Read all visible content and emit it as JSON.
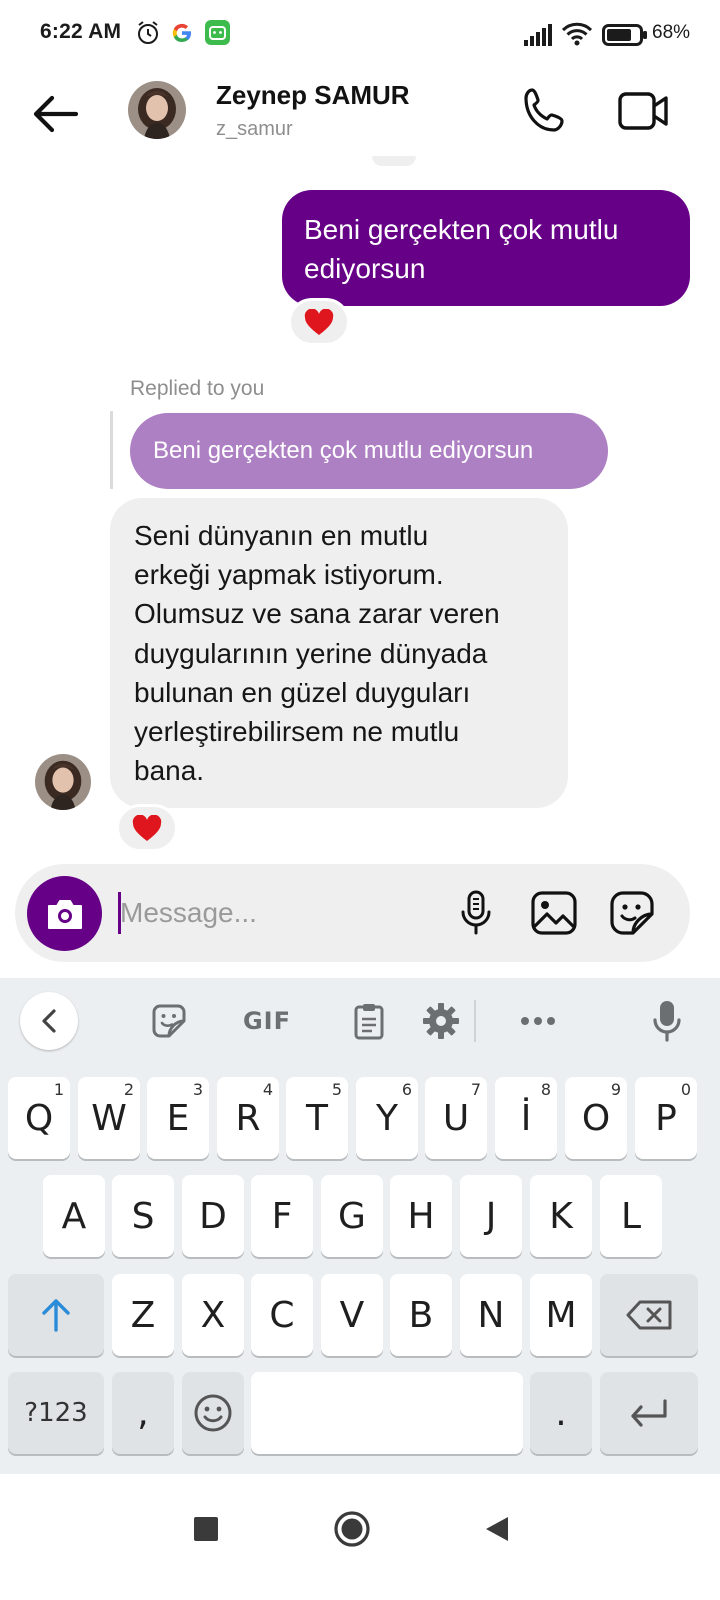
{
  "status_bar": {
    "time": "6:22 AM",
    "battery": "68%",
    "icons": [
      "alarm-icon",
      "google-icon",
      "app-notification-icon",
      "signal-icon",
      "wifi-icon",
      "battery-icon"
    ]
  },
  "header": {
    "name": "Zeynep SAMUR",
    "username": "z_samur",
    "icons": [
      "back-arrow-icon",
      "avatar",
      "phone-icon",
      "video-camera-icon"
    ]
  },
  "messages": [
    {
      "direction": "outgoing",
      "text": "Beni gerçekten çok mutlu ediyorsun",
      "reaction": "❤️"
    },
    {
      "direction": "incoming",
      "reply_label": "Replied to you",
      "quoted_text": "Beni gerçekten çok mutlu ediyorsun",
      "text": "Seni dünyanın en mutlu erkeği yapmak istiyorum. Olumsuz ve sana zarar veren duygularının yerine dünyada bulunan en güzel duyguları yerleştirebilirsem ne mutlu bana.",
      "reaction": "❤️"
    }
  ],
  "incoming_lines": [
    "Seni dünyanın en mutlu",
    "erkeği yapmak istiyorum.",
    "Olumsuz ve sana zarar veren",
    "duygularının yerine dünyada",
    "bulunan en güzel duyguları",
    "yerleştirebilirsem ne mutlu",
    "bana."
  ],
  "outgoing_lines": [
    "Beni gerçekten çok mutlu",
    "ediyorsun"
  ],
  "composer": {
    "value": "",
    "placeholder": "Message...",
    "icons": [
      "camera-icon",
      "microphone-icon",
      "gallery-icon",
      "sticker-icon"
    ]
  },
  "keyboard": {
    "toolbar": {
      "gif_label": "GIF",
      "icons": [
        "collapse-icon",
        "sticker-icon",
        "clipboard-icon",
        "settings-icon",
        "more-icon",
        "voice-input-icon"
      ]
    },
    "row1": [
      {
        "label": "Q",
        "hint": "1"
      },
      {
        "label": "W",
        "hint": "2"
      },
      {
        "label": "E",
        "hint": "3"
      },
      {
        "label": "R",
        "hint": "4"
      },
      {
        "label": "T",
        "hint": "5"
      },
      {
        "label": "Y",
        "hint": "6"
      },
      {
        "label": "U",
        "hint": "7"
      },
      {
        "label": "İ",
        "hint": "8"
      },
      {
        "label": "O",
        "hint": "9"
      },
      {
        "label": "P",
        "hint": "0"
      }
    ],
    "row2": [
      "A",
      "S",
      "D",
      "F",
      "G",
      "H",
      "J",
      "K",
      "L"
    ],
    "row3": [
      "Z",
      "X",
      "C",
      "V",
      "B",
      "N",
      "M"
    ],
    "row4": {
      "symbols": "?123",
      "comma": ",",
      "period": "."
    }
  },
  "nav_bar": {
    "icons": [
      "recent-apps-icon",
      "home-icon",
      "back-icon"
    ]
  },
  "colors": {
    "accent": "#650087",
    "reply_quote": "#ad7fc3",
    "incoming_bubble": "#efefef",
    "heart": "#e0161e"
  }
}
